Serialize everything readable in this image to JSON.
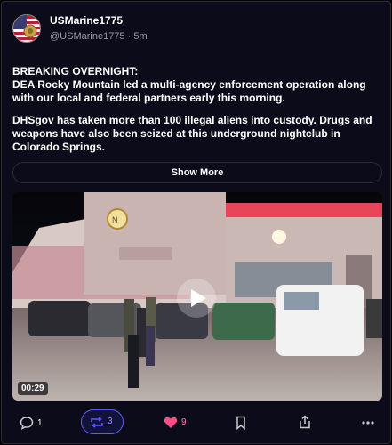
{
  "user": {
    "display_name": "USMarine1775",
    "handle": "@USMarine1775",
    "time": "5m"
  },
  "post": {
    "line1": "BREAKING OVERNIGHT:",
    "line2": "DEA Rocky Mountain led a multi-agency enforcement operation along with our local and federal partners early this morning.",
    "paragraph2": "DHSgov has taken more than 100 illegal aliens into custody. Drugs and weapons have also been seized at this underground nightclub in Colorado Springs."
  },
  "show_more_label": "Show More",
  "video": {
    "duration": "00:29"
  },
  "actions": {
    "reply_count": "1",
    "repost_count": "3",
    "like_count": "9"
  },
  "colors": {
    "background": "#0b0b1a",
    "accent": "#5b5bff",
    "like": "#ff4f8b"
  },
  "icons": [
    "reply-icon",
    "repost-icon",
    "heart-icon",
    "bookmark-icon",
    "share-icon",
    "more-icon",
    "play-icon"
  ]
}
